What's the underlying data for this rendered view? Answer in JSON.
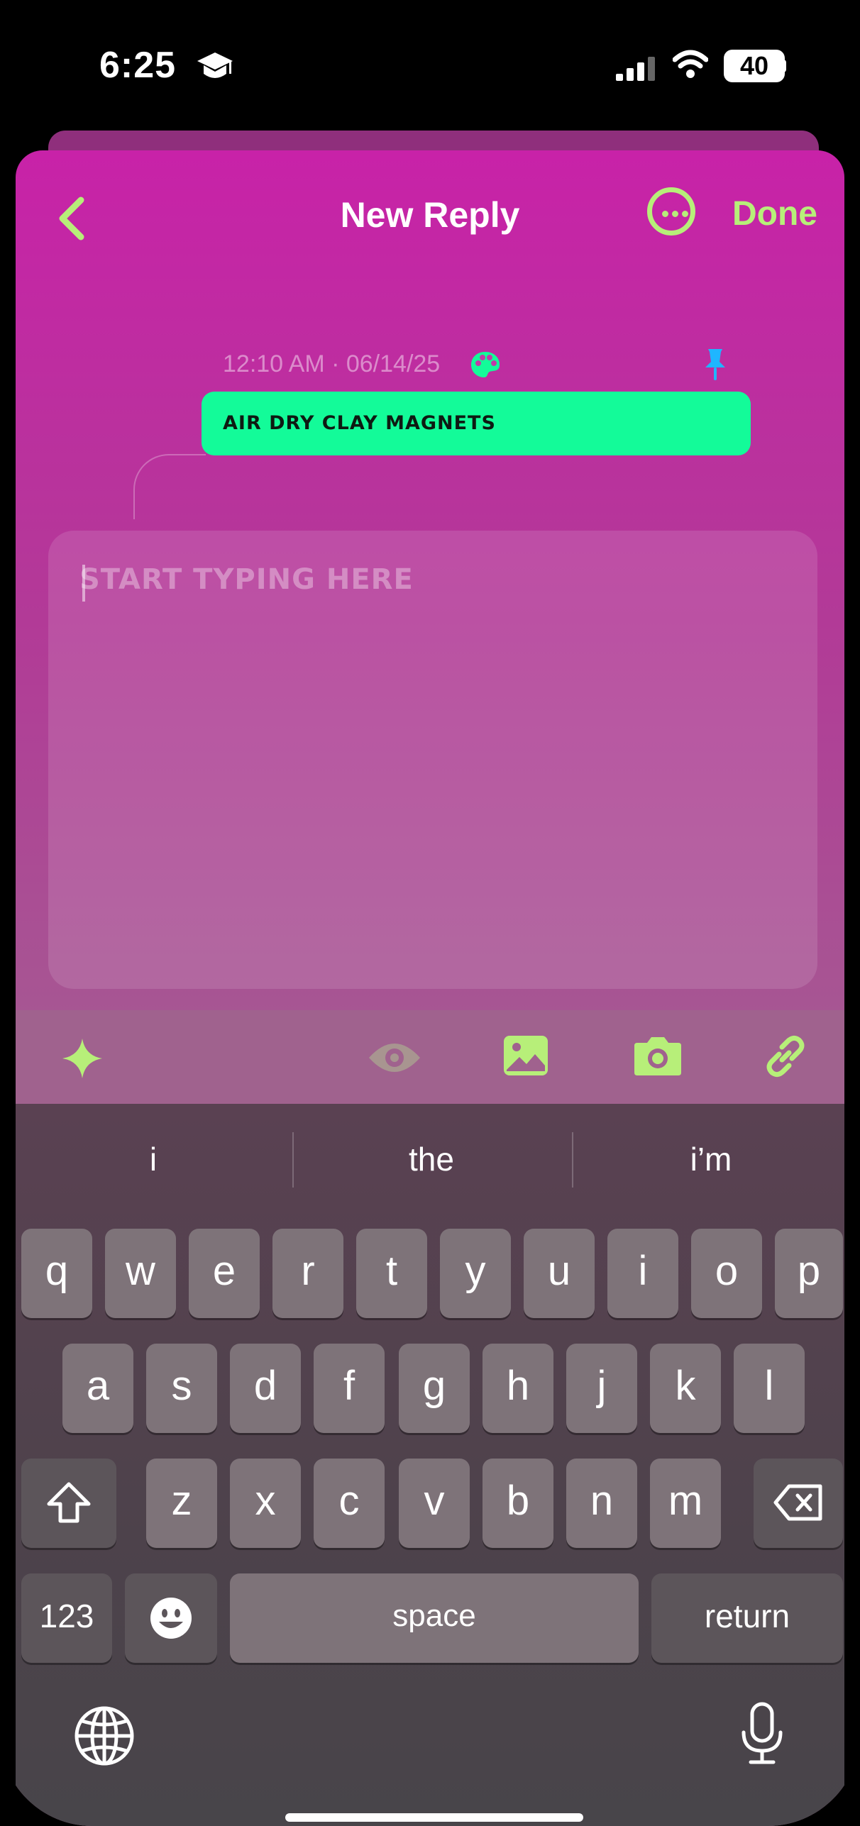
{
  "status_bar": {
    "time": "6:25",
    "battery": "40"
  },
  "nav": {
    "title": "New Reply",
    "done_label": "Done"
  },
  "message": {
    "meta": "12:10 AM · 06/14/25",
    "text": "AIR DRY CLAY MAGNETS"
  },
  "editor": {
    "placeholder": "START TYPING HERE"
  },
  "toolbar": {
    "icons": [
      "sparkle-icon",
      "eye-icon",
      "image-icon",
      "camera-icon",
      "link-icon"
    ]
  },
  "keyboard": {
    "suggestions": [
      "i",
      "the",
      "i’m"
    ],
    "row1": [
      "q",
      "w",
      "e",
      "r",
      "t",
      "y",
      "u",
      "i",
      "o",
      "p"
    ],
    "row2": [
      "a",
      "s",
      "d",
      "f",
      "g",
      "h",
      "j",
      "k",
      "l"
    ],
    "row3": [
      "z",
      "x",
      "c",
      "v",
      "b",
      "n",
      "m"
    ],
    "numbers_label": "123",
    "space_label": "space",
    "return_label": "return"
  },
  "colors": {
    "accent_green": "#b7ef79",
    "bubble_green": "#13fb99",
    "sheet_top": "#c822a8",
    "pin_blue": "#1fb6ff"
  }
}
